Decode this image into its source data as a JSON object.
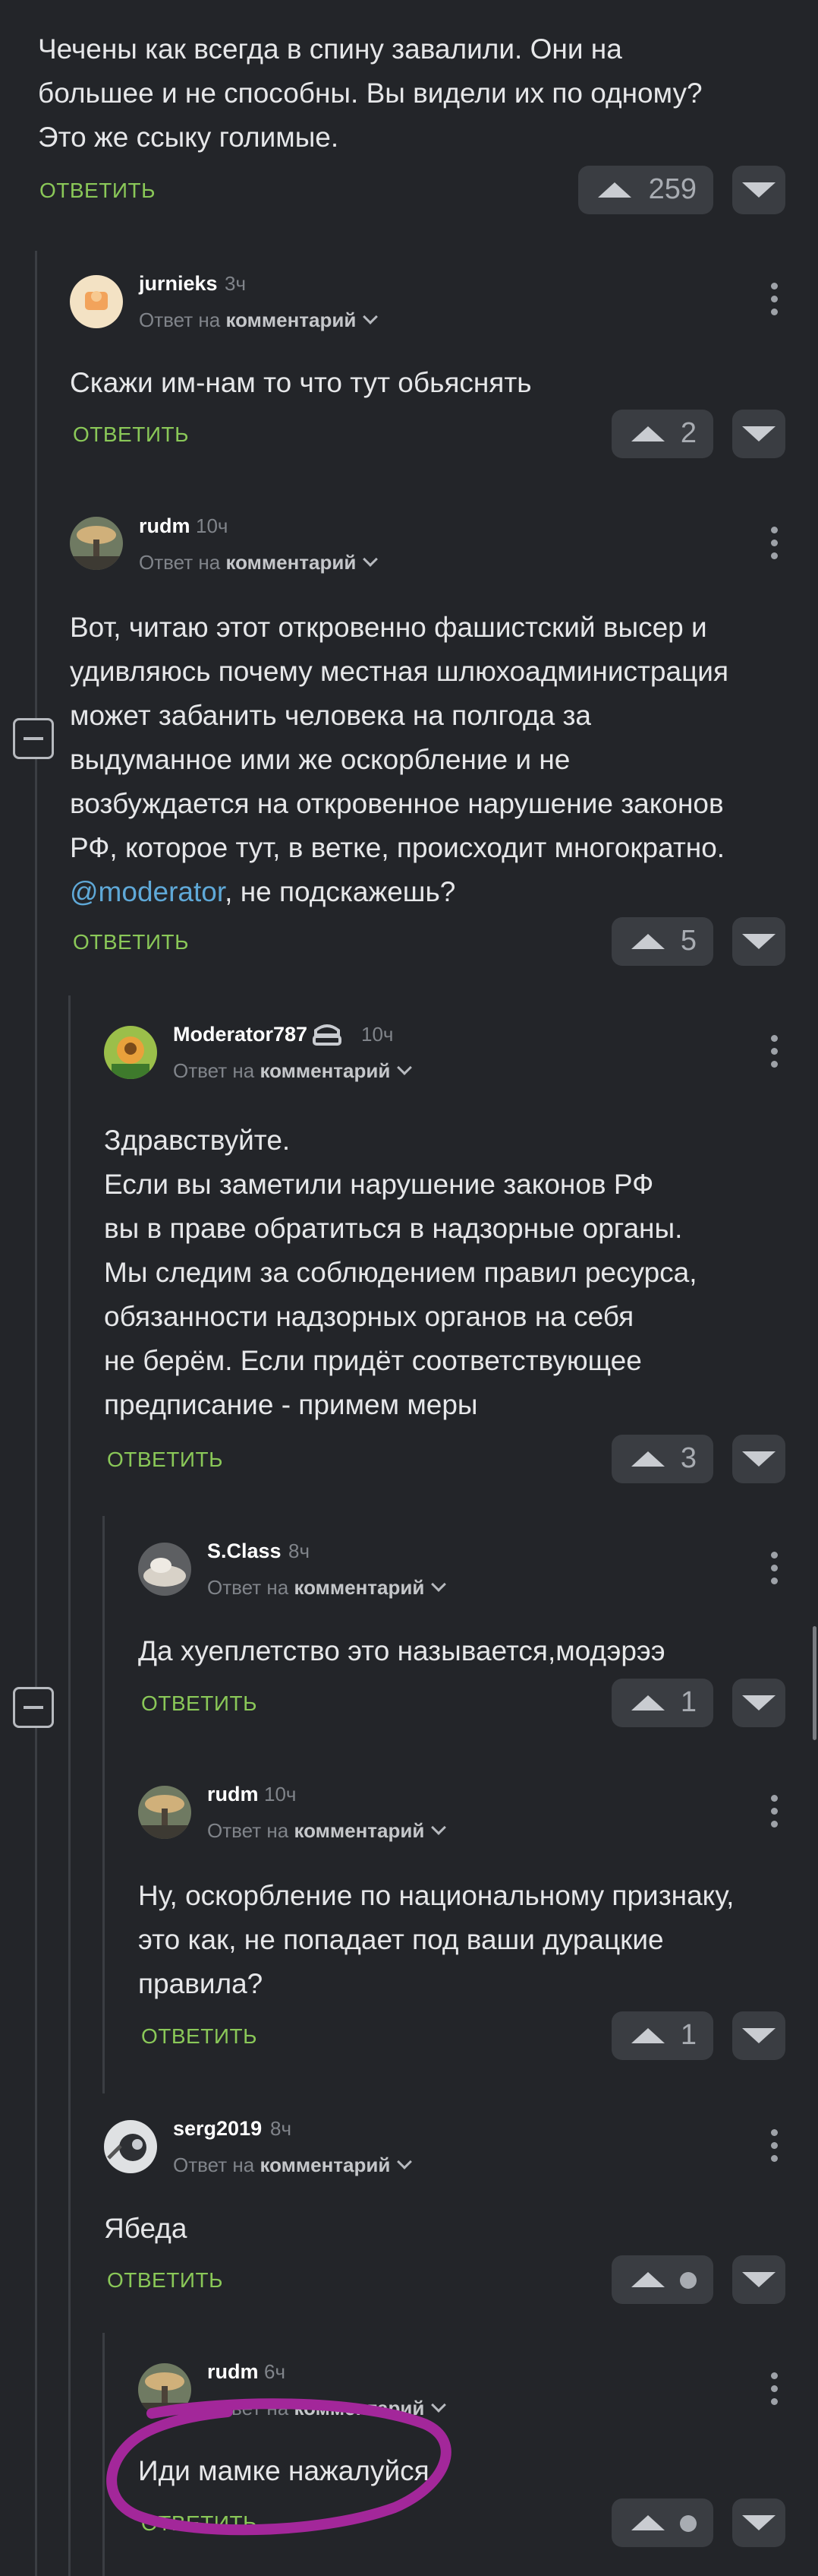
{
  "top_comment": {
    "lines": [
      "Чечены как всегда в спину завалили. Они на",
      "большее и не способны. Вы видели их по одному?",
      "Это же ссыку голимые."
    ],
    "reply": "ОТВЕТИТЬ",
    "votes": "259"
  },
  "comments": [
    {
      "author": "jurnieks",
      "time": "3ч",
      "meta_prefix": "Ответ на",
      "meta_target": "комментарий",
      "lines": [
        "Скажи им-нам то что тут обьяснять"
      ],
      "reply": "ОТВЕТИТЬ",
      "votes": "2"
    },
    {
      "author": "rudm",
      "time": "10ч",
      "meta_prefix": "Ответ на",
      "meta_target": "комментарий",
      "lines": [
        "Вот, читаю этот откровенно фашистский высер и",
        "удивляюсь почему местная шлюхоадминистрация",
        "может забанить человека на полгода за",
        "выдуманное ими же оскорбление и не",
        "возбуждается на откровенное нарушение законов",
        "РФ, которое тут, в ветке, происходит многократно."
      ],
      "mention": "@moderator",
      "mention_tail": ", не подскажешь?",
      "reply": "ОТВЕТИТЬ",
      "votes": "5"
    },
    {
      "author": "Moderator787",
      "time": "10ч",
      "meta_prefix": "Ответ на",
      "meta_target": "комментарий",
      "lines": [
        "Здравствуйте.",
        "Если вы заметили нарушение законов РФ",
        "вы в праве обратиться в надзорные органы.",
        "Мы следим за соблюдением правил ресурса,",
        "обязанности надзорных органов на себя",
        "не берём. Если придёт соответствующее",
        "предписание - примем меры"
      ],
      "reply": "ОТВЕТИТЬ",
      "votes": "3"
    },
    {
      "author": "S.Class",
      "time": "8ч",
      "meta_prefix": "Ответ на",
      "meta_target": "комментарий",
      "lines": [
        "Да хуеплетство это называется,модэрээ"
      ],
      "reply": "ОТВЕТИТЬ",
      "votes": "1"
    },
    {
      "author": "rudm",
      "time": "10ч",
      "meta_prefix": "Ответ на",
      "meta_target": "комментарий",
      "lines": [
        "Ну, оскорбление по национальному признаку,",
        "это как, не попадает под ваши дурацкие",
        "правила?"
      ],
      "reply": "ОТВЕТИТЬ",
      "votes": "1"
    },
    {
      "author": "serg2019",
      "time": "8ч",
      "meta_prefix": "Ответ на",
      "meta_target": "комментарий",
      "lines": [
        "Ябеда"
      ],
      "reply": "ОТВЕТИТЬ",
      "votes": ""
    },
    {
      "author": "rudm",
      "time": "6ч",
      "meta_prefix": "Ответ на",
      "meta_target": "комментарий",
      "lines": [
        "Иди мамке нажалуйся"
      ],
      "reply": "ОТВЕТИТЬ",
      "votes": ""
    }
  ],
  "colors": {
    "background": "#232529",
    "reply_green": "#8ac858",
    "mention_blue": "#5fa9d8",
    "highlight_ring": "#a3279a"
  }
}
